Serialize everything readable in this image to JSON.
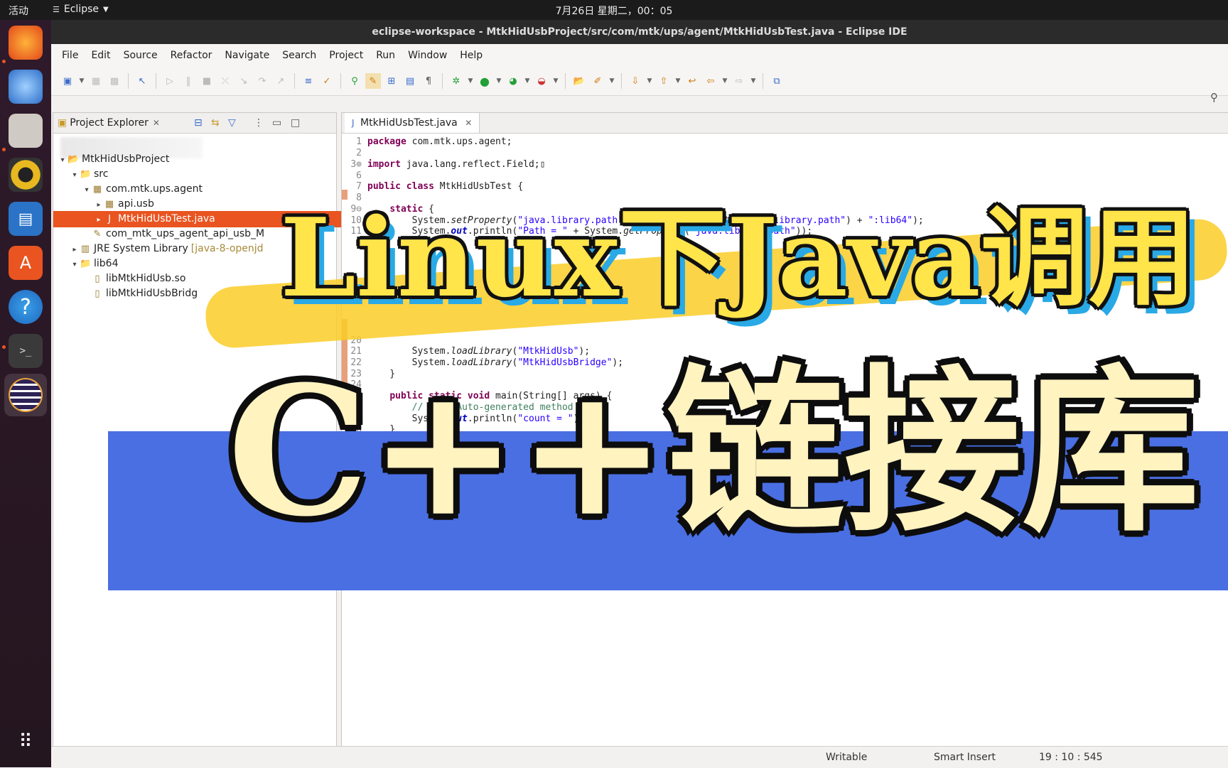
{
  "topbar": {
    "activities": "活动",
    "app_name": "Eclipse",
    "clock": "7月26日 星期二，00：05"
  },
  "window": {
    "title": "eclipse-workspace - MtkHidUsbProject/src/com/mtk/ups/agent/MtkHidUsbTest.java - Eclipse IDE"
  },
  "menu": [
    "File",
    "Edit",
    "Source",
    "Refactor",
    "Navigate",
    "Search",
    "Project",
    "Run",
    "Window",
    "Help"
  ],
  "explorer": {
    "title": "Project Explorer",
    "rows": [
      {
        "label": "MtkHidUsbProject",
        "indent": 0,
        "twisty": "▾",
        "icon": "project-icon",
        "glyph": "📂"
      },
      {
        "label": "src",
        "indent": 1,
        "twisty": "▾",
        "icon": "source-folder-icon",
        "glyph": "📁"
      },
      {
        "label": "com.mtk.ups.agent",
        "indent": 2,
        "twisty": "▾",
        "icon": "package-icon",
        "glyph": "▦"
      },
      {
        "label": "api.usb",
        "indent": 3,
        "twisty": "▸",
        "icon": "package-icon",
        "glyph": "▦"
      },
      {
        "label": "MtkHidUsbTest.java",
        "indent": 3,
        "twisty": "▸",
        "icon": "java-file-icon",
        "glyph": "J",
        "selected": true
      },
      {
        "label": "com_mtk_ups_agent_api_usb_M",
        "indent": 2,
        "twisty": "",
        "icon": "header-file-icon",
        "glyph": "✎"
      },
      {
        "label": "JRE System Library",
        "suffix": "[java-8-openjd",
        "indent": 1,
        "twisty": "▸",
        "icon": "library-icon",
        "glyph": "▥"
      },
      {
        "label": "lib64",
        "indent": 1,
        "twisty": "▾",
        "icon": "folder-icon",
        "glyph": "📁"
      },
      {
        "label": "libMtkHidUsb.so",
        "indent": 2,
        "twisty": "",
        "icon": "file-icon",
        "glyph": "▯"
      },
      {
        "label": "libMtkHidUsbBridg",
        "indent": 2,
        "twisty": "",
        "icon": "file-icon",
        "glyph": "▯"
      }
    ]
  },
  "editor": {
    "tab_label": "MtkHidUsbTest.java",
    "lines": [
      {
        "n": "1",
        "html": "<span class=\"kw\">package</span> com.mtk.ups.agent;"
      },
      {
        "n": "2",
        "html": ""
      },
      {
        "n": "3⊕",
        "html": "<span class=\"kw\">import</span> java.lang.reflect.Field;▯"
      },
      {
        "n": "6",
        "html": ""
      },
      {
        "n": "7",
        "html": "<span class=\"kw\">public class</span> MtkHidUsbTest {"
      },
      {
        "n": "8",
        "html": ""
      },
      {
        "n": "9⊖",
        "html": "    <span class=\"kw\">static</span> {"
      },
      {
        "n": "10",
        "html": "        System.<span class=\"it\">setProperty</span>(<span class=\"str\">\"java.library.path\"</span>, System.<span class=\"it\">getProperty</span>(<span class=\"str\">\"java.library.path\"</span>) + <span class=\"str\">\":lib64\"</span>);"
      },
      {
        "n": "11",
        "html": "        System.<span class=\"fld\">out</span>.println(<span class=\"str\">\"Path = \"</span> + System.<span class=\"it\">getProperty</span>(<span class=\"str\">\"java.library.path\"</span>));"
      },
      {
        "n": "20",
        "html": ""
      },
      {
        "n": "21",
        "html": "        System.<span class=\"it\">loadLibrary</span>(<span class=\"str\">\"MtkHidUsb\"</span>);"
      },
      {
        "n": "22",
        "html": "        System.<span class=\"it\">loadLibrary</span>(<span class=\"str\">\"MtkHidUsbBridge\"</span>);"
      },
      {
        "n": "23",
        "html": "    }"
      },
      {
        "n": "24",
        "html": ""
      },
      {
        "n": "25⊖",
        "html": "    <span class=\"kw\">public static void</span> main(String[] args) {"
      },
      {
        "n": "26",
        "html": "        <span class=\"cmt\">// TODO Auto-generated method stub</span>"
      },
      {
        "n": "27",
        "html": "        System.<span class=\"fld\">out</span>.println(<span class=\"str\">\"count = \"</span>);"
      },
      {
        "n": "28",
        "html": "    }"
      }
    ]
  },
  "statusbar": {
    "writable": "Writable",
    "insert_mode": "Smart Insert",
    "position": "19 : 10 : 545"
  },
  "overlay": {
    "line1": "Linux下Java调用",
    "line2": "C++链接库"
  },
  "colors": {
    "selection": "#e95420",
    "overlay_band": "#4a6fe3",
    "overlay_text_yellow": "#ffe44a"
  }
}
